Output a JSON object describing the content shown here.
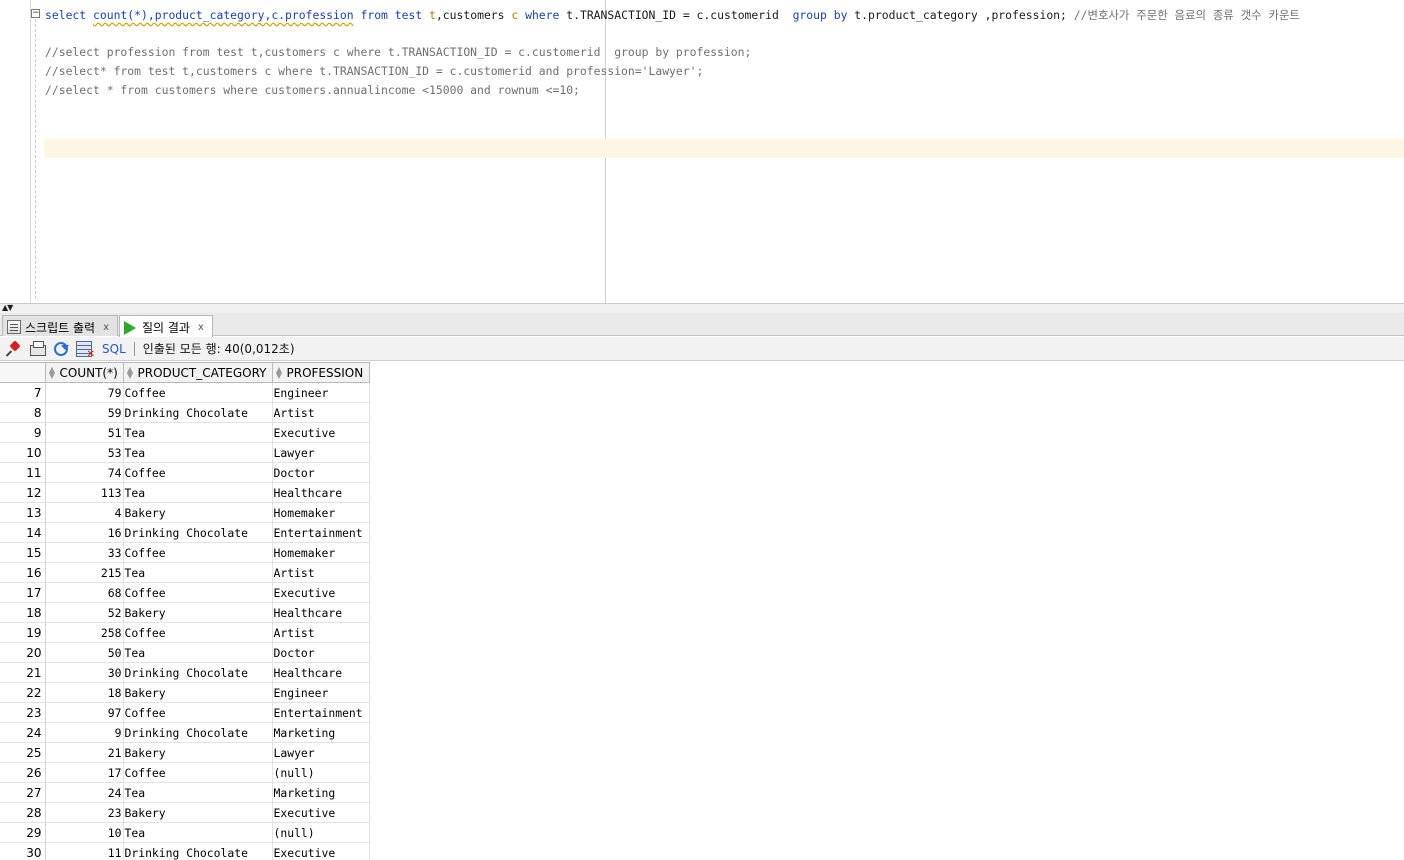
{
  "editor": {
    "line1": {
      "select": "select",
      "count": "count(*),product_category,c.profession",
      "from": "from",
      "test": "test",
      "t": "t",
      "customers": ",customers",
      "c": "c",
      "where": "where",
      "cond": "t.TRANSACTION_ID = c.customerid",
      "groupby": "group by",
      "rest": "t.product_category ,profession;",
      "comment": "//변호사가 주문한 음료의 종류 갯수 카운트"
    },
    "line2": "//select profession from test t,customers c where t.TRANSACTION_ID = c.customerid  group by profession;",
    "line3": "//select* from test t,customers c where t.TRANSACTION_ID = c.customerid and profession='Lawyer';",
    "line4": "//select * from customers where customers.annualincome <15000 and rownum <=10;"
  },
  "tabs": {
    "script_output": "스크립트 출력",
    "query_result": "질의 결과",
    "close": "x"
  },
  "toolbar": {
    "sql_label": "SQL",
    "status": "인출된 모든 행: 40(0,012초)"
  },
  "icons": {
    "pin": "pin-icon",
    "print": "printer-icon",
    "refresh": "refresh-icon",
    "clear": "clear-grid-icon",
    "script": "script-output-icon",
    "run": "run-icon"
  },
  "grid": {
    "columns": [
      "COUNT(*)",
      "PRODUCT_CATEGORY",
      "PROFESSION"
    ],
    "rows": [
      [
        "7",
        "79",
        "Coffee",
        "Engineer"
      ],
      [
        "8",
        "59",
        "Drinking Chocolate",
        "Artist"
      ],
      [
        "9",
        "51",
        "Tea",
        "Executive"
      ],
      [
        "10",
        "53",
        "Tea",
        "Lawyer"
      ],
      [
        "11",
        "74",
        "Coffee",
        "Doctor"
      ],
      [
        "12",
        "113",
        "Tea",
        "Healthcare"
      ],
      [
        "13",
        "4",
        "Bakery",
        "Homemaker"
      ],
      [
        "14",
        "16",
        "Drinking Chocolate",
        "Entertainment"
      ],
      [
        "15",
        "33",
        "Coffee",
        "Homemaker"
      ],
      [
        "16",
        "215",
        "Tea",
        "Artist"
      ],
      [
        "17",
        "68",
        "Coffee",
        "Executive"
      ],
      [
        "18",
        "52",
        "Bakery",
        "Healthcare"
      ],
      [
        "19",
        "258",
        "Coffee",
        "Artist"
      ],
      [
        "20",
        "50",
        "Tea",
        "Doctor"
      ],
      [
        "21",
        "30",
        "Drinking Chocolate",
        "Healthcare"
      ],
      [
        "22",
        "18",
        "Bakery",
        "Engineer"
      ],
      [
        "23",
        "97",
        "Coffee",
        "Entertainment"
      ],
      [
        "24",
        "9",
        "Drinking Chocolate",
        "Marketing"
      ],
      [
        "25",
        "21",
        "Bakery",
        "Lawyer"
      ],
      [
        "26",
        "17",
        "Coffee",
        "(null)"
      ],
      [
        "27",
        "24",
        "Tea",
        "Marketing"
      ],
      [
        "28",
        "23",
        "Bakery",
        "Executive"
      ],
      [
        "29",
        "10",
        "Tea",
        "(null)"
      ],
      [
        "30",
        "11",
        "Drinking Chocolate",
        "Executive"
      ]
    ]
  }
}
